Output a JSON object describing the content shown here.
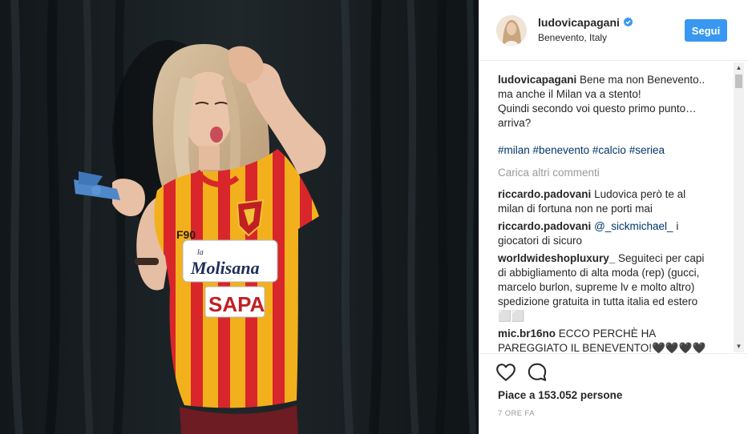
{
  "post": {
    "username": "ludovicapagani",
    "location": "Benevento, Italy",
    "follow_label": "Segui",
    "caption": {
      "user": "ludovicapagani",
      "text": "Bene ma non Benevento..\nma anche il Milan va a stento!\nQuindi secondo voi questo primo punto…\narriva?"
    },
    "hashtags": [
      "#milan",
      "#benevento",
      "#calcio",
      "#seriea"
    ],
    "load_more_label": "Carica altri commenti",
    "comments": [
      {
        "user": "riccardo.padovani",
        "mention": "",
        "text": "Ludovica però te al milan di fortuna non ne porti mai"
      },
      {
        "user": "riccardo.padovani",
        "mention": "@_sickmichael_",
        "text": "i giocatori di sicuro"
      },
      {
        "user": "worldwideshopluxury_",
        "mention": "",
        "text": "Seguiteci per capi di abbigliamento di alta moda (rep) (gucci, marcelo burlon, supreme lv e molto altro) spedizione gratuita in tutta italia ed estero ⬜⬜"
      },
      {
        "user": "mic.br16no",
        "mention": "",
        "text": "ECCO PERCHÈ HA PAREGGIATO IL BENEVENTO!🖤🖤🖤🖤🖤"
      }
    ],
    "likes_label": "Piace a 153.052 persone",
    "time_label": "7 ORE FA",
    "photo_jersey": {
      "sponsor_1": "la Molisana",
      "sponsor_2": "SAPA",
      "kit_brand": "F90"
    }
  },
  "colors": {
    "follow_button": "#3897f0",
    "link": "#003569",
    "muted": "#999999",
    "jersey_yellow": "#f4b41a",
    "jersey_red": "#d8242a",
    "curtain": "#1b2124"
  }
}
